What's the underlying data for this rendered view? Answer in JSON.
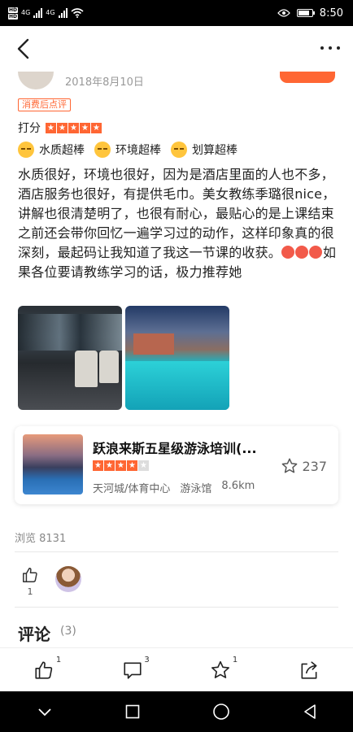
{
  "status_bar": {
    "sim1": "HD",
    "sim2": "HD",
    "network1": "4G",
    "network2": "4G",
    "time": "8:50",
    "battery_level": 0.8
  },
  "review": {
    "date": "2018年8月10日",
    "tag": "消费后点评",
    "rating_label": "打分",
    "rating_stars": 5,
    "praises": [
      "水质超棒",
      "环境超棒",
      "划算超棒"
    ],
    "text_before_emoji": "水质很好，环境也很好，因为是酒店里面的人也不多，酒店服务也很好，有提供毛巾。美女教练季璐很nice，讲解也很清楚明了，也很有耐心，最贴心的是上课结束之前还会带你回忆一遍学习过的动作，这样印象真的很深刻，最起码让我知道了我这一节课的收获。",
    "text_after_emoji": "如果各位要请教练学习的话，极力推荐她"
  },
  "shop": {
    "name": "跃浪来斯五星级游泳培训(...",
    "stars": 4,
    "favorites": "237",
    "area": "天河城/体育中心",
    "category": "游泳馆",
    "distance": "8.6km"
  },
  "views": "浏览 8131",
  "likes_count": "1",
  "comments": {
    "title": "评论",
    "count": "(3)"
  },
  "bottom_bar": {
    "like_count": "1",
    "comment_count": "3",
    "favorite_count": "1"
  },
  "colors": {
    "accent": "#ff6633"
  }
}
